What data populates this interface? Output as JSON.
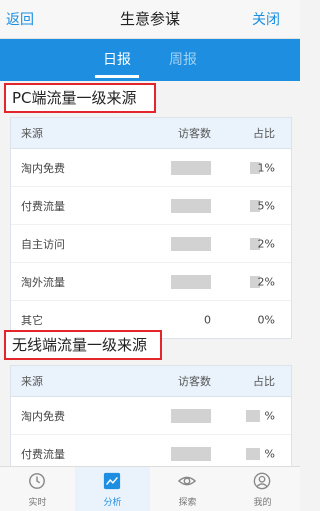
{
  "header": {
    "back_label": "返回",
    "title": "生意参谋",
    "close_label": "关闭"
  },
  "tabs": [
    {
      "label": "日报",
      "active": true
    },
    {
      "label": "周报",
      "active": false
    }
  ],
  "sections": [
    {
      "title": "PC端流量一级来源",
      "columns": {
        "source": "来源",
        "visitors": "访客数",
        "share": "占比"
      },
      "rows": [
        {
          "source": "淘内免费",
          "visitors": "",
          "share": "1%"
        },
        {
          "source": "付费流量",
          "visitors": "",
          "share": "5%"
        },
        {
          "source": "自主访问",
          "visitors": "",
          "share": "2%"
        },
        {
          "source": "淘外流量",
          "visitors": "",
          "share": "2%"
        },
        {
          "source": "其它",
          "visitors": "0",
          "share": "0%"
        }
      ]
    },
    {
      "title": "无线端流量一级来源",
      "columns": {
        "source": "来源",
        "visitors": "访客数",
        "share": "占比"
      },
      "rows": [
        {
          "source": "淘内免费",
          "visitors": "",
          "share": "%"
        },
        {
          "source": "付费流量",
          "visitors": "",
          "share": "%"
        }
      ]
    }
  ],
  "bottom_nav": [
    {
      "label": "实时",
      "icon": "clock-icon",
      "active": false
    },
    {
      "label": "分析",
      "icon": "chart-icon",
      "active": true
    },
    {
      "label": "探索",
      "icon": "eye-icon",
      "active": false
    },
    {
      "label": "我的",
      "icon": "user-icon",
      "active": false
    }
  ],
  "colors": {
    "accent": "#1e8fe0",
    "highlight_box": "#e3262b"
  }
}
